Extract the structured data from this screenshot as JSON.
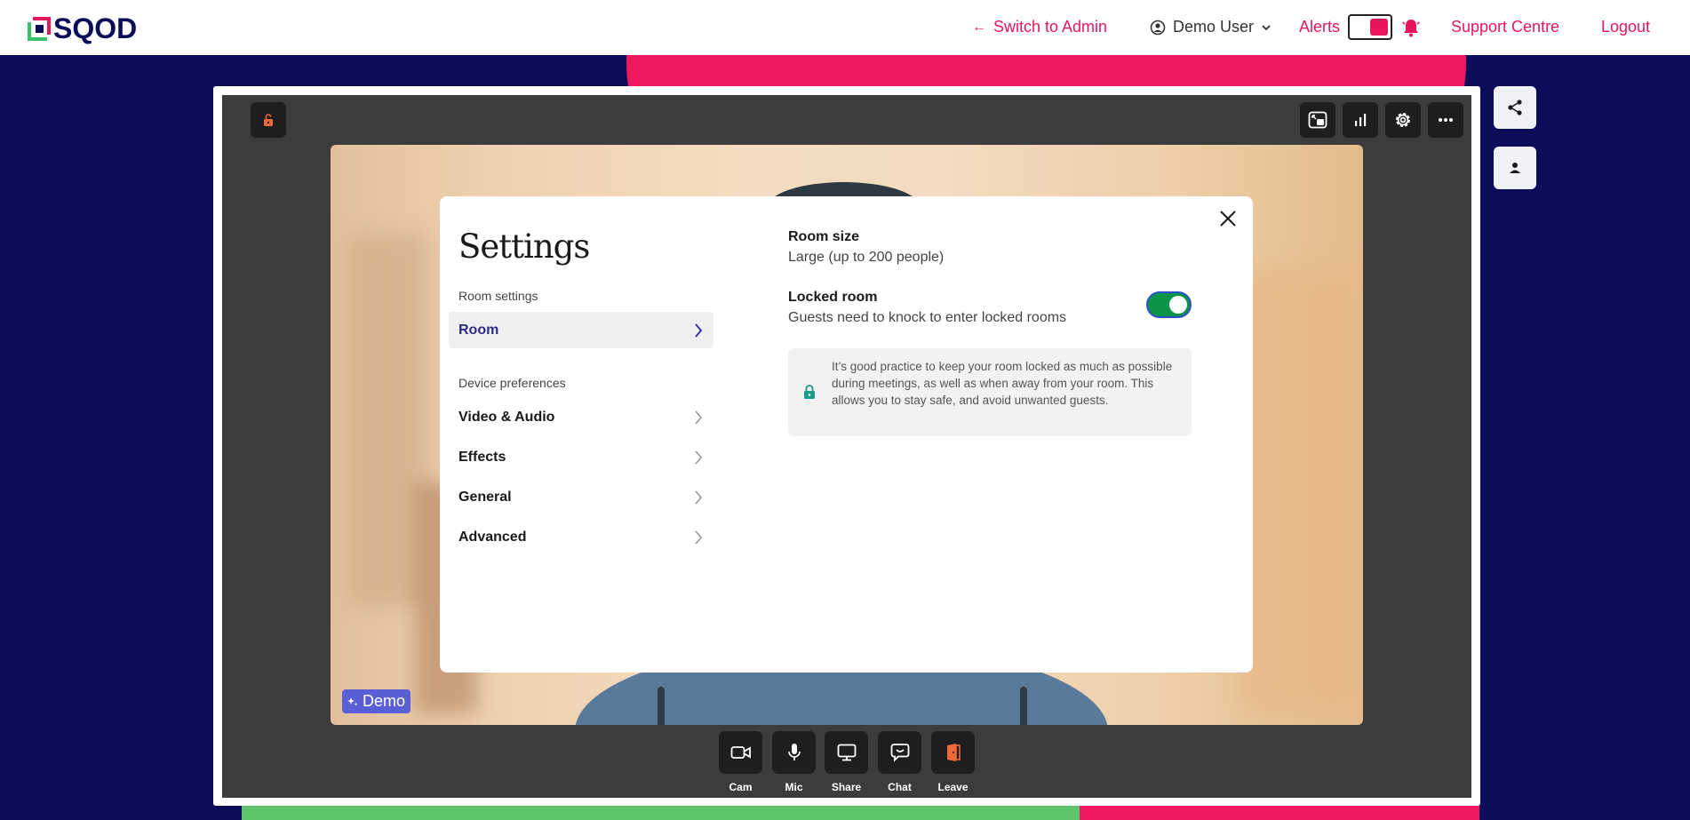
{
  "brand": {
    "name": "SQOD"
  },
  "nav": {
    "switch_admin": "Switch to Admin",
    "user": "Demo User",
    "alerts": "Alerts",
    "support": "Support Centre",
    "logout": "Logout"
  },
  "settings": {
    "title": "Settings",
    "room_settings_label": "Room settings",
    "room_item": "Room",
    "device_label": "Device preferences",
    "items": [
      "Video & Audio",
      "Effects",
      "General",
      "Advanced"
    ],
    "room_size_title": "Room size",
    "room_size_value": "Large (up to 200 people)",
    "locked_title": "Locked room",
    "locked_desc": "Guests need to knock to enter locked rooms",
    "locked_enabled": true,
    "info_text": "It’s good practice to keep your room locked as much as possible during meetings, as well as when away from your room. This allows you to stay safe, and avoid unwanted guests."
  },
  "video": {
    "tag": "Demo"
  },
  "controls": [
    {
      "label": "Cam",
      "icon": "camera-icon"
    },
    {
      "label": "Mic",
      "icon": "mic-icon"
    },
    {
      "label": "Share",
      "icon": "screen-share-icon"
    },
    {
      "label": "Chat",
      "icon": "chat-icon"
    },
    {
      "label": "Leave",
      "icon": "leave-door-icon"
    }
  ],
  "colors": {
    "brand_pink": "#e8175d",
    "navy": "#0b0d5a",
    "toggle_on": "#0c9448",
    "active_purple": "#2f2c8a"
  }
}
